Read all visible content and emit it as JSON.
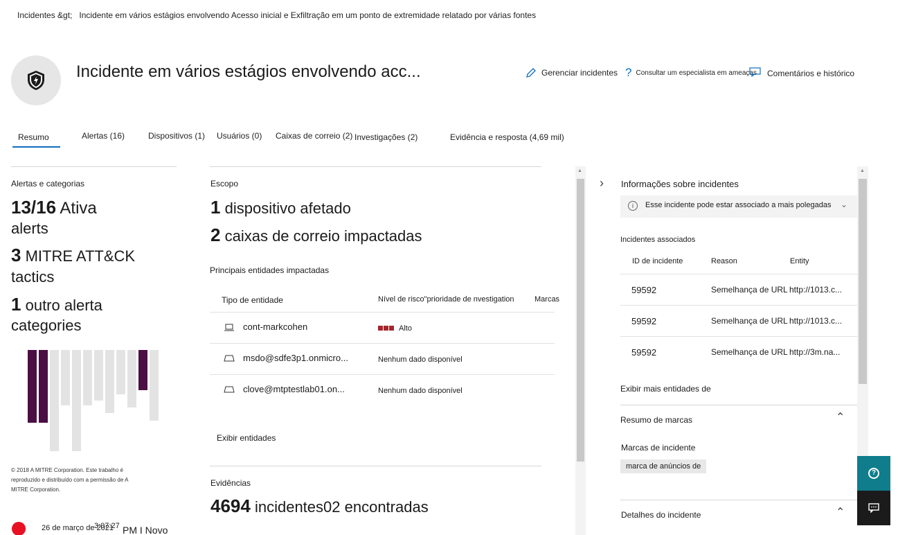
{
  "breadcrumb": {
    "root": "Incidentes &gt;",
    "current": "Incidente em vários estágios envolvendo Acesso inicial e Exfiltração em um ponto de extremidade relatado por várias fontes"
  },
  "header": {
    "title": "Incidente em vários estágios envolvendo acc...",
    "manage_label": "Gerenciar incidentes",
    "consult_label": "Consultar um especialista em ameaças",
    "comments_label": "Comentários e histórico"
  },
  "tabs": [
    {
      "label": "Resumo"
    },
    {
      "label": "Alertas (16)"
    },
    {
      "label": "Dispositivos (1)"
    },
    {
      "label": "Usuários (0)"
    },
    {
      "label": "Caixas de correio (2)"
    },
    {
      "label": "Investigações (2)"
    },
    {
      "label": "Evidência e resposta (4,69 mil)"
    }
  ],
  "alerts_categories": {
    "heading": "Alertas e categorias",
    "active_count": "13/16",
    "active_label": "Ativa",
    "active_label2": "alerts",
    "mitre_count": "3",
    "mitre_label": "MITRE ATT&CK",
    "mitre_label2": "tactics",
    "other_count": "1",
    "other_label": "outro alerta",
    "other_label2": "categories",
    "bars": [
      {
        "top_frac": 0.3,
        "bottom_frac": 0.72,
        "color": "#4b0f43"
      },
      {
        "top_frac": 0.3,
        "bottom_frac": 0.72,
        "color": "#4b0f43"
      },
      {
        "top_frac": 0.0,
        "bottom_frac": 1.0,
        "color": "#e3e3e3"
      },
      {
        "top_frac": 0.0,
        "bottom_frac": 0.55,
        "color": "#e3e3e3"
      },
      {
        "top_frac": 0.0,
        "bottom_frac": 1.0,
        "color": "#e3e3e3"
      },
      {
        "top_frac": 0.0,
        "bottom_frac": 0.55,
        "color": "#e3e3e3"
      },
      {
        "top_frac": 0.0,
        "bottom_frac": 0.5,
        "color": "#e3e3e3"
      },
      {
        "top_frac": 0.0,
        "bottom_frac": 0.62,
        "color": "#e3e3e3"
      },
      {
        "top_frac": 0.0,
        "bottom_frac": 0.44,
        "color": "#e3e3e3"
      },
      {
        "top_frac": 0.0,
        "bottom_frac": 0.57,
        "color": "#e3e3e3"
      },
      {
        "top_frac": 0.0,
        "bottom_frac": 0.4,
        "color": "#4b0f43"
      },
      {
        "top_frac": 0.0,
        "bottom_frac": 0.7,
        "color": "#e3e3e3"
      }
    ],
    "copyright": "© 2018 A MITRE Corporation. Este trabalho é reproduzido e distribuído com a permissão de A MITRE Corporation."
  },
  "footer_left": {
    "date": "26 de março de 2021",
    "time": "3:07:27",
    "suffix": "PM I Novo"
  },
  "scope": {
    "heading": "Escopo",
    "devices_count": "1",
    "devices_label": "dispositivo afetado",
    "mailboxes_count": "2",
    "mailboxes_label": "caixas de correio impactadas",
    "entities_heading": "Principais entidades impactadas",
    "col_type": "Tipo de entidade",
    "col_risk": "Nível de risco\"prioridade de nvestigation",
    "col_tags": "Marcas",
    "entities": [
      {
        "name": "cont-markcohen",
        "risk": "Alto",
        "icon": "laptop-icon"
      },
      {
        "name": "msdo@sdfe3p1.onmicro...",
        "risk": "Nenhum dado disponível",
        "icon": "mailbox-icon"
      },
      {
        "name": "clove@mtptestlab01.on...",
        "risk": "Nenhum dado disponível",
        "icon": "mailbox-icon"
      }
    ],
    "view_entities": "Exibir entidades"
  },
  "evidence": {
    "heading": "Evidências",
    "count": "4694",
    "label": "incidentes02 encontradas"
  },
  "incident_info": {
    "heading": "Informações sobre incidentes",
    "notice": "Esse incidente pode estar associado a mais polegadas",
    "associated_heading": "Incidentes associados",
    "col_id": "ID de incidente",
    "col_reason": "Reason",
    "col_entity": "Entity",
    "rows": [
      {
        "id": "59592",
        "reason": "Semelhança de URL",
        "entity": "http://1013.c..."
      },
      {
        "id": "59592",
        "reason": "Semelhança de URL",
        "entity": "http://1013.c..."
      },
      {
        "id": "59592",
        "reason": "Semelhança de URL",
        "entity": "http://3m.na..."
      }
    ],
    "view_more": "Exibir mais entidades de",
    "tags_summary": "Resumo de marcas",
    "incident_tags": "Marcas de incidente",
    "tag_chip": "marca de anúncios de",
    "details": "Detalhes do incidente"
  },
  "colors": {
    "accent": "#0f6cbd",
    "risk_high": "#a4262c",
    "mitre_bar": "#4b0f43",
    "float_button": "#0f7d8c",
    "float_button_dark": "#1b1b1b",
    "status_dot": "#e81123"
  }
}
